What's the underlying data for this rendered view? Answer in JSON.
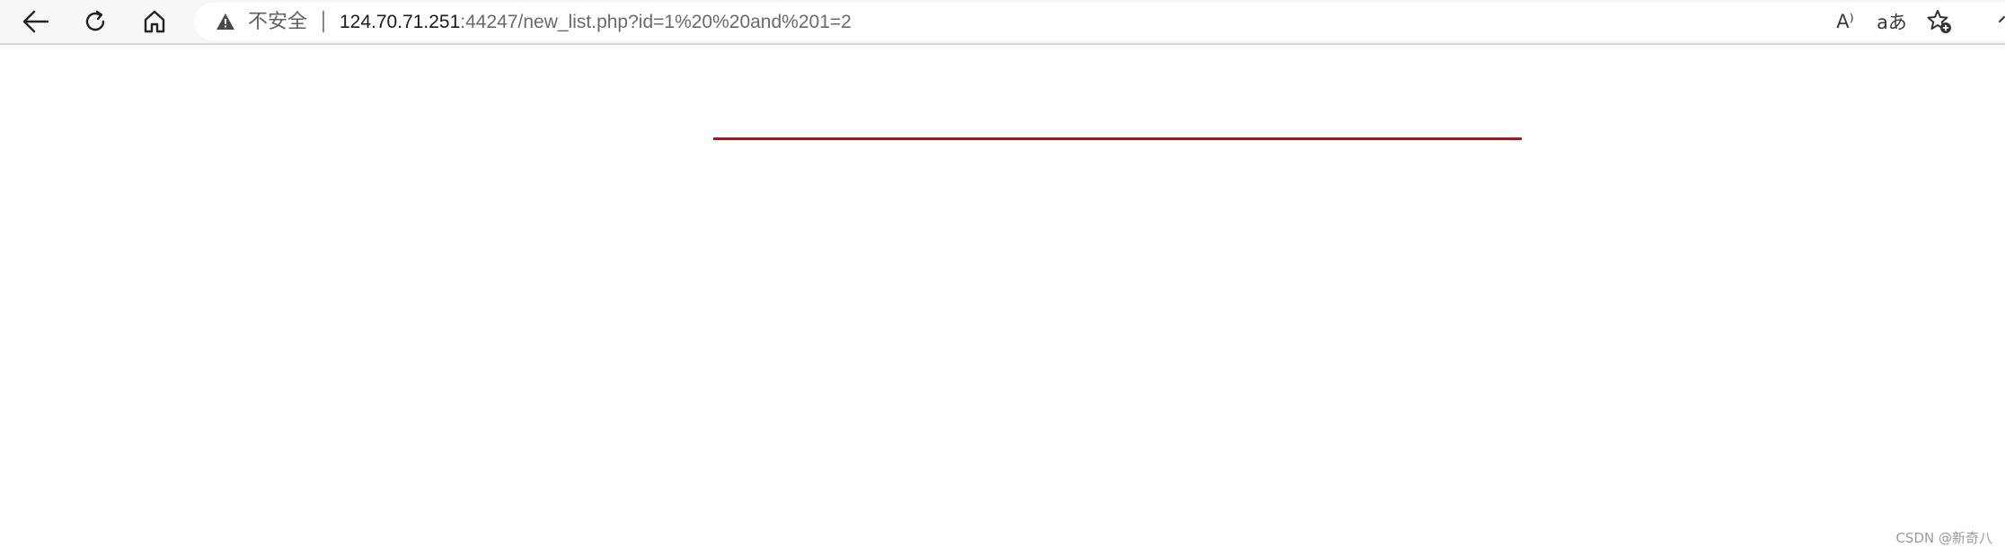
{
  "browser": {
    "nav": {
      "back_icon": "arrow-left-icon",
      "refresh_icon": "refresh-icon",
      "home_icon": "home-icon"
    },
    "address_bar": {
      "security_icon": "warning-triangle-icon",
      "security_label": "不安全",
      "url_host": "124.70.71.251",
      "url_rest": ":44247/new_list.php?id=1%20%20and%201=2",
      "icons": {
        "read_aloud_icon": "A⁾",
        "translate_icon": "aあ",
        "favorite_icon": "star-add-icon"
      }
    }
  },
  "page": {
    "rule_color": "#e00000"
  },
  "watermark": {
    "text": "CSDN @新奇八"
  }
}
